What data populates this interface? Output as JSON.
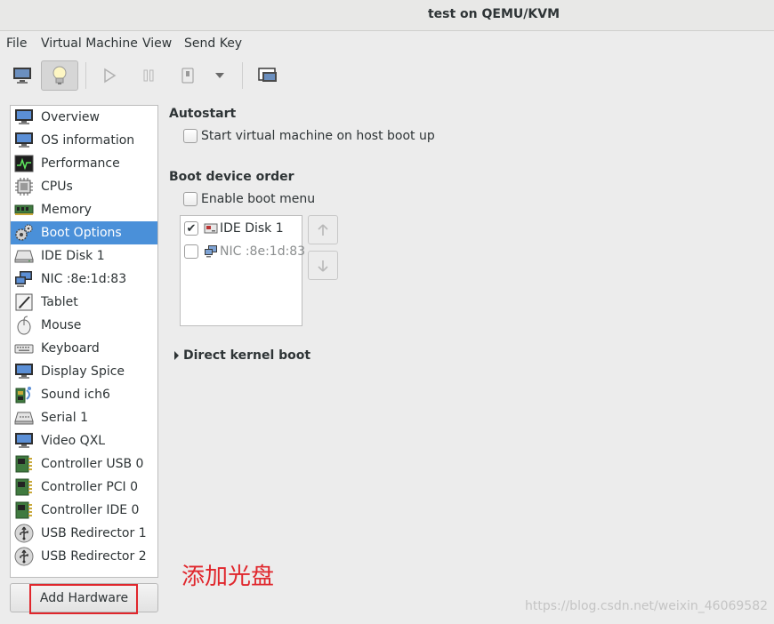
{
  "window": {
    "title": "test on QEMU/KVM"
  },
  "menubar": {
    "items": [
      {
        "label": "File"
      },
      {
        "label": "Virtual Machine"
      },
      {
        "label": "View"
      },
      {
        "label": "Send Key"
      }
    ]
  },
  "toolbar": {
    "buttons": [
      {
        "icon": "monitor-icon",
        "active": false
      },
      {
        "icon": "lightbulb-icon",
        "active": true
      },
      {
        "icon": "play-icon",
        "active": false
      },
      {
        "icon": "pause-icon",
        "active": false
      },
      {
        "icon": "power-icon",
        "active": false
      },
      {
        "icon": "chevron-down-icon",
        "active": false
      },
      {
        "icon": "console-icon",
        "active": false
      }
    ]
  },
  "hardware": {
    "items": [
      {
        "label": "Overview",
        "icon": "monitor-icon"
      },
      {
        "label": "OS information",
        "icon": "monitor-icon"
      },
      {
        "label": "Performance",
        "icon": "performance-icon"
      },
      {
        "label": "CPUs",
        "icon": "cpu-icon"
      },
      {
        "label": "Memory",
        "icon": "memory-icon"
      },
      {
        "label": "Boot Options",
        "icon": "gears-icon",
        "selected": true
      },
      {
        "label": "IDE Disk 1",
        "icon": "disk-icon"
      },
      {
        "label": "NIC :8e:1d:83",
        "icon": "network-icon"
      },
      {
        "label": "Tablet",
        "icon": "tablet-icon"
      },
      {
        "label": "Mouse",
        "icon": "mouse-icon"
      },
      {
        "label": "Keyboard",
        "icon": "keyboard-icon"
      },
      {
        "label": "Display Spice",
        "icon": "display-icon"
      },
      {
        "label": "Sound ich6",
        "icon": "sound-icon"
      },
      {
        "label": "Serial 1",
        "icon": "serial-icon"
      },
      {
        "label": "Video QXL",
        "icon": "video-icon"
      },
      {
        "label": "Controller USB 0",
        "icon": "controller-icon"
      },
      {
        "label": "Controller PCI 0",
        "icon": "controller-icon"
      },
      {
        "label": "Controller IDE 0",
        "icon": "controller-icon"
      },
      {
        "label": "USB Redirector 1",
        "icon": "usb-icon"
      },
      {
        "label": "USB Redirector 2",
        "icon": "usb-icon"
      }
    ],
    "add_button": "Add Hardware"
  },
  "autostart": {
    "title": "Autostart",
    "checkbox_label": "Start virtual machine on host boot up",
    "checked": false
  },
  "boot_order": {
    "title": "Boot device order",
    "enable_menu_label": "Enable boot menu",
    "enable_menu_checked": false,
    "devices": [
      {
        "label": "IDE Disk 1",
        "checked": true,
        "icon": "disk-icon"
      },
      {
        "label": "NIC :8e:1d:83",
        "checked": false,
        "icon": "network-icon"
      }
    ],
    "move_up_icon": "arrow-up-icon",
    "move_down_icon": "arrow-down-icon"
  },
  "direct_kernel_boot": {
    "label": "Direct kernel boot"
  },
  "annotation": {
    "text": "添加光盘",
    "color": "#e0262c"
  },
  "watermark": {
    "text": "https://blog.csdn.net/weixin_46069582"
  },
  "colors": {
    "selection": "#4a90d9",
    "annotation_red": "#e0262c"
  }
}
